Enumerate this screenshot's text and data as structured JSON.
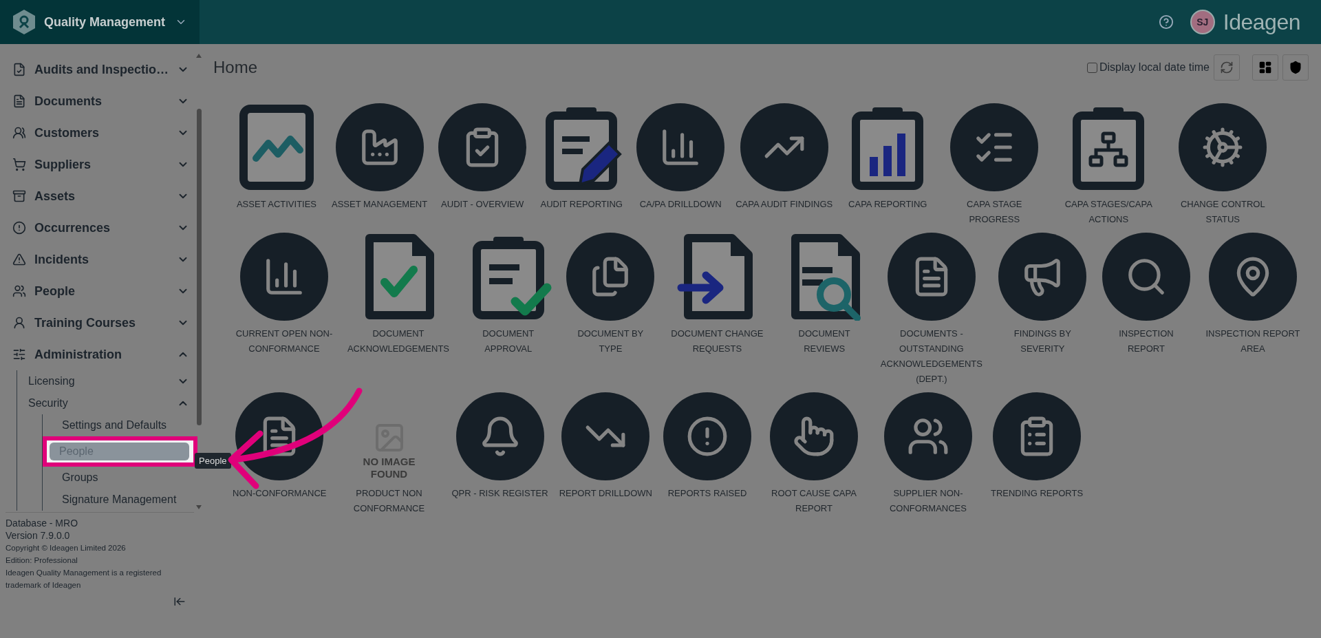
{
  "header": {
    "app_title": "Quality Management",
    "avatar_initials": "SJ",
    "brand": "Ideagen"
  },
  "sidebar": {
    "nav": [
      {
        "label": "Audits and Inspectio…",
        "kind": "audits",
        "expanded": false
      },
      {
        "label": "Documents",
        "kind": "documents",
        "expanded": false
      },
      {
        "label": "Customers",
        "kind": "customers",
        "expanded": false
      },
      {
        "label": "Suppliers",
        "kind": "suppliers",
        "expanded": false
      },
      {
        "label": "Assets",
        "kind": "assets",
        "expanded": false
      },
      {
        "label": "Occurrences",
        "kind": "occurrences",
        "expanded": false
      },
      {
        "label": "Incidents",
        "kind": "incidents",
        "expanded": false
      },
      {
        "label": "People",
        "kind": "people",
        "expanded": false
      },
      {
        "label": "Training Courses",
        "kind": "training",
        "expanded": false
      },
      {
        "label": "Administration",
        "kind": "administration",
        "expanded": true,
        "children": [
          {
            "label": "Licensing",
            "expanded": false
          },
          {
            "label": "Security",
            "expanded": true,
            "children": [
              {
                "label": "Settings and Defaults",
                "selected": false
              },
              {
                "label": "People",
                "selected": true,
                "tooltip": "People"
              },
              {
                "label": "Groups",
                "selected": false
              },
              {
                "label": "Signature Management",
                "selected": false
              }
            ]
          }
        ]
      }
    ],
    "footer": {
      "database": "Database - MRO",
      "version": "Version 7.9.0.0",
      "notes": [
        "Copyright © Ideagen Limited 2026",
        "Edition: Professional",
        "Ideagen Quality Management is a registered trademark of Ideagen"
      ]
    }
  },
  "page": {
    "title": "Home",
    "local_time_option": {
      "label": "Display local date time",
      "checked": false
    }
  },
  "tile_rows": [
    [
      {
        "label": "ASSET ACTIVITIES",
        "kind": "frame-zigzag"
      },
      {
        "label": "ASSET MANAGEMENT",
        "kind": "factory"
      },
      {
        "label": "AUDIT - OVERVIEW",
        "kind": "clipboard-check"
      },
      {
        "label": "AUDIT REPORTING",
        "kind": "clipboard-pencil"
      },
      {
        "label": "CA/PA DRILLDOWN",
        "kind": "bar-chart"
      },
      {
        "label": "CAPA AUDIT FINDINGS",
        "kind": "trend"
      },
      {
        "label": "CAPA REPORTING",
        "kind": "clipboard-bars"
      },
      {
        "label": "CAPA STAGE PROGRESS",
        "kind": "checklist"
      },
      {
        "label": "CAPA STAGES/CAPA ACTIONS",
        "kind": "clipboard-hierarchy"
      },
      {
        "label": "CHANGE CONTROL STATUS",
        "kind": "gears"
      }
    ],
    [
      {
        "label": "CURRENT OPEN NON-CONFORMANCE",
        "kind": "bar-chart"
      },
      {
        "label": "DOCUMENT ACKNOWLEDGEMENTS",
        "kind": "document-check"
      },
      {
        "label": "DOCUMENT APPROVAL",
        "kind": "clipboard-approve"
      },
      {
        "label": "DOCUMENT BY TYPE",
        "kind": "files"
      },
      {
        "label": "DOCUMENT CHANGE REQUESTS",
        "kind": "document-arrow"
      },
      {
        "label": "DOCUMENT REVIEWS",
        "kind": "document-search"
      },
      {
        "label": "DOCUMENTS - OUTSTANDING ACKNOWLEDGEMENTS (DEPT.)",
        "kind": "document-stack"
      },
      {
        "label": "FINDINGS BY SEVERITY",
        "kind": "megaphone"
      },
      {
        "label": "INSPECTION REPORT",
        "kind": "search"
      },
      {
        "label": "INSPECTION REPORT AREA",
        "kind": "map-pin"
      }
    ],
    [
      {
        "label": "NON-CONFORMANCE",
        "kind": "document-alert"
      },
      {
        "label": "PRODUCT NON CONFORMANCE",
        "kind": "no-image",
        "image_text": "NO IMAGE FOUND"
      },
      {
        "label": "QPR - RISK REGISTER",
        "kind": "bell"
      },
      {
        "label": "REPORT DRILLDOWN",
        "kind": "falling-chart"
      },
      {
        "label": "REPORTS RAISED",
        "kind": "alert"
      },
      {
        "label": "ROOT CAUSE CAPA REPORT",
        "kind": "pointer"
      },
      {
        "label": "SUPPLIER NON-CONFORMANCES",
        "kind": "people"
      },
      {
        "label": "TRENDING REPORTS",
        "kind": "clipboard-list"
      }
    ]
  ]
}
